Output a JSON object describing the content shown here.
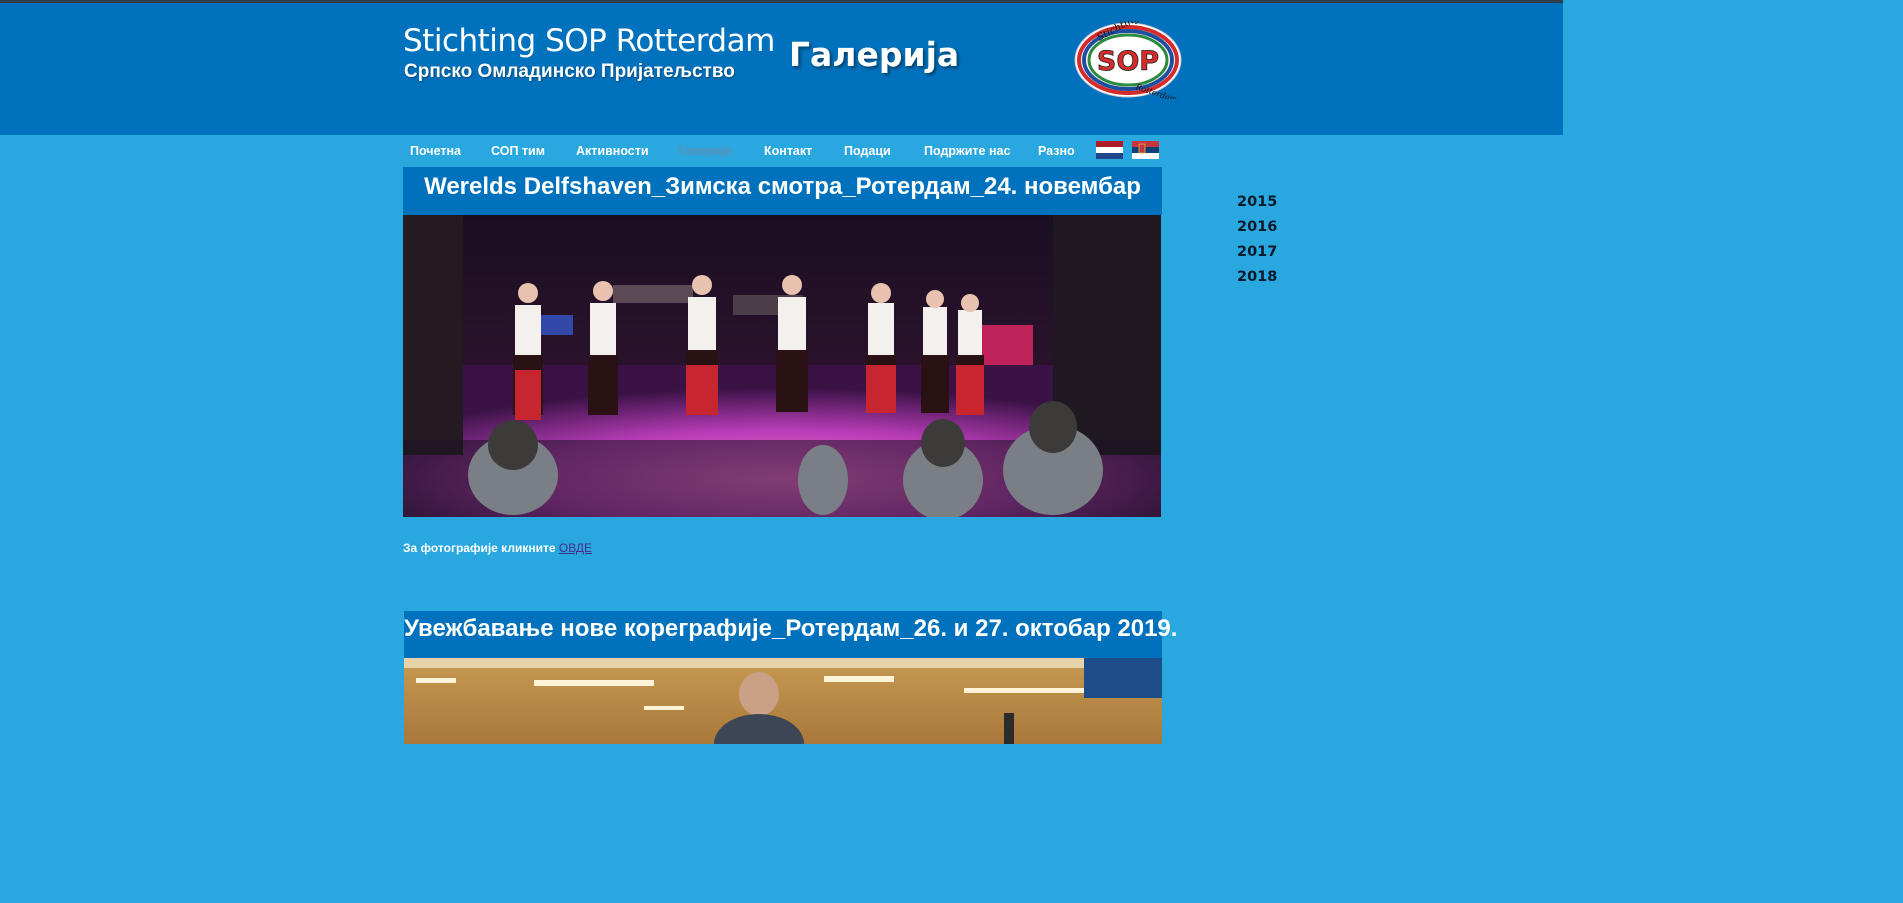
{
  "header": {
    "site_title": "Stichting SOP Rotterdam",
    "site_subtitle": "Српско Омладинско Пријатељство",
    "page_heading": "Галерија",
    "logo": {
      "center": "SOP",
      "top": "Stichting",
      "bottom": "Rotterdam"
    }
  },
  "nav": {
    "items": [
      {
        "label": "Почетна"
      },
      {
        "label": "СОП тим"
      },
      {
        "label": "Активности"
      },
      {
        "label": "Галерија",
        "active": true
      },
      {
        "label": "Контакт"
      },
      {
        "label": "Подаци"
      },
      {
        "label": "Подржите нас"
      },
      {
        "label": "Разно"
      }
    ],
    "flags": [
      "netherlands-flag-icon",
      "serbia-flag-icon"
    ]
  },
  "sidebar": {
    "years": [
      "2015",
      "2016",
      "2017",
      "2018"
    ]
  },
  "posts": [
    {
      "title": "Werelds Delfshaven_Зимска смотра_Ротердам_24. новембар",
      "photo_note": "За фотографије кликните",
      "photo_link": "ОВДЕ"
    },
    {
      "title": "Увежбавање нове кореграфије_Ротердам_26. и 27. октобар 2019."
    }
  ],
  "colors": {
    "page_background": "#29a8e0",
    "header_background": "#0071bc",
    "active_nav": "#5f8fb5"
  }
}
